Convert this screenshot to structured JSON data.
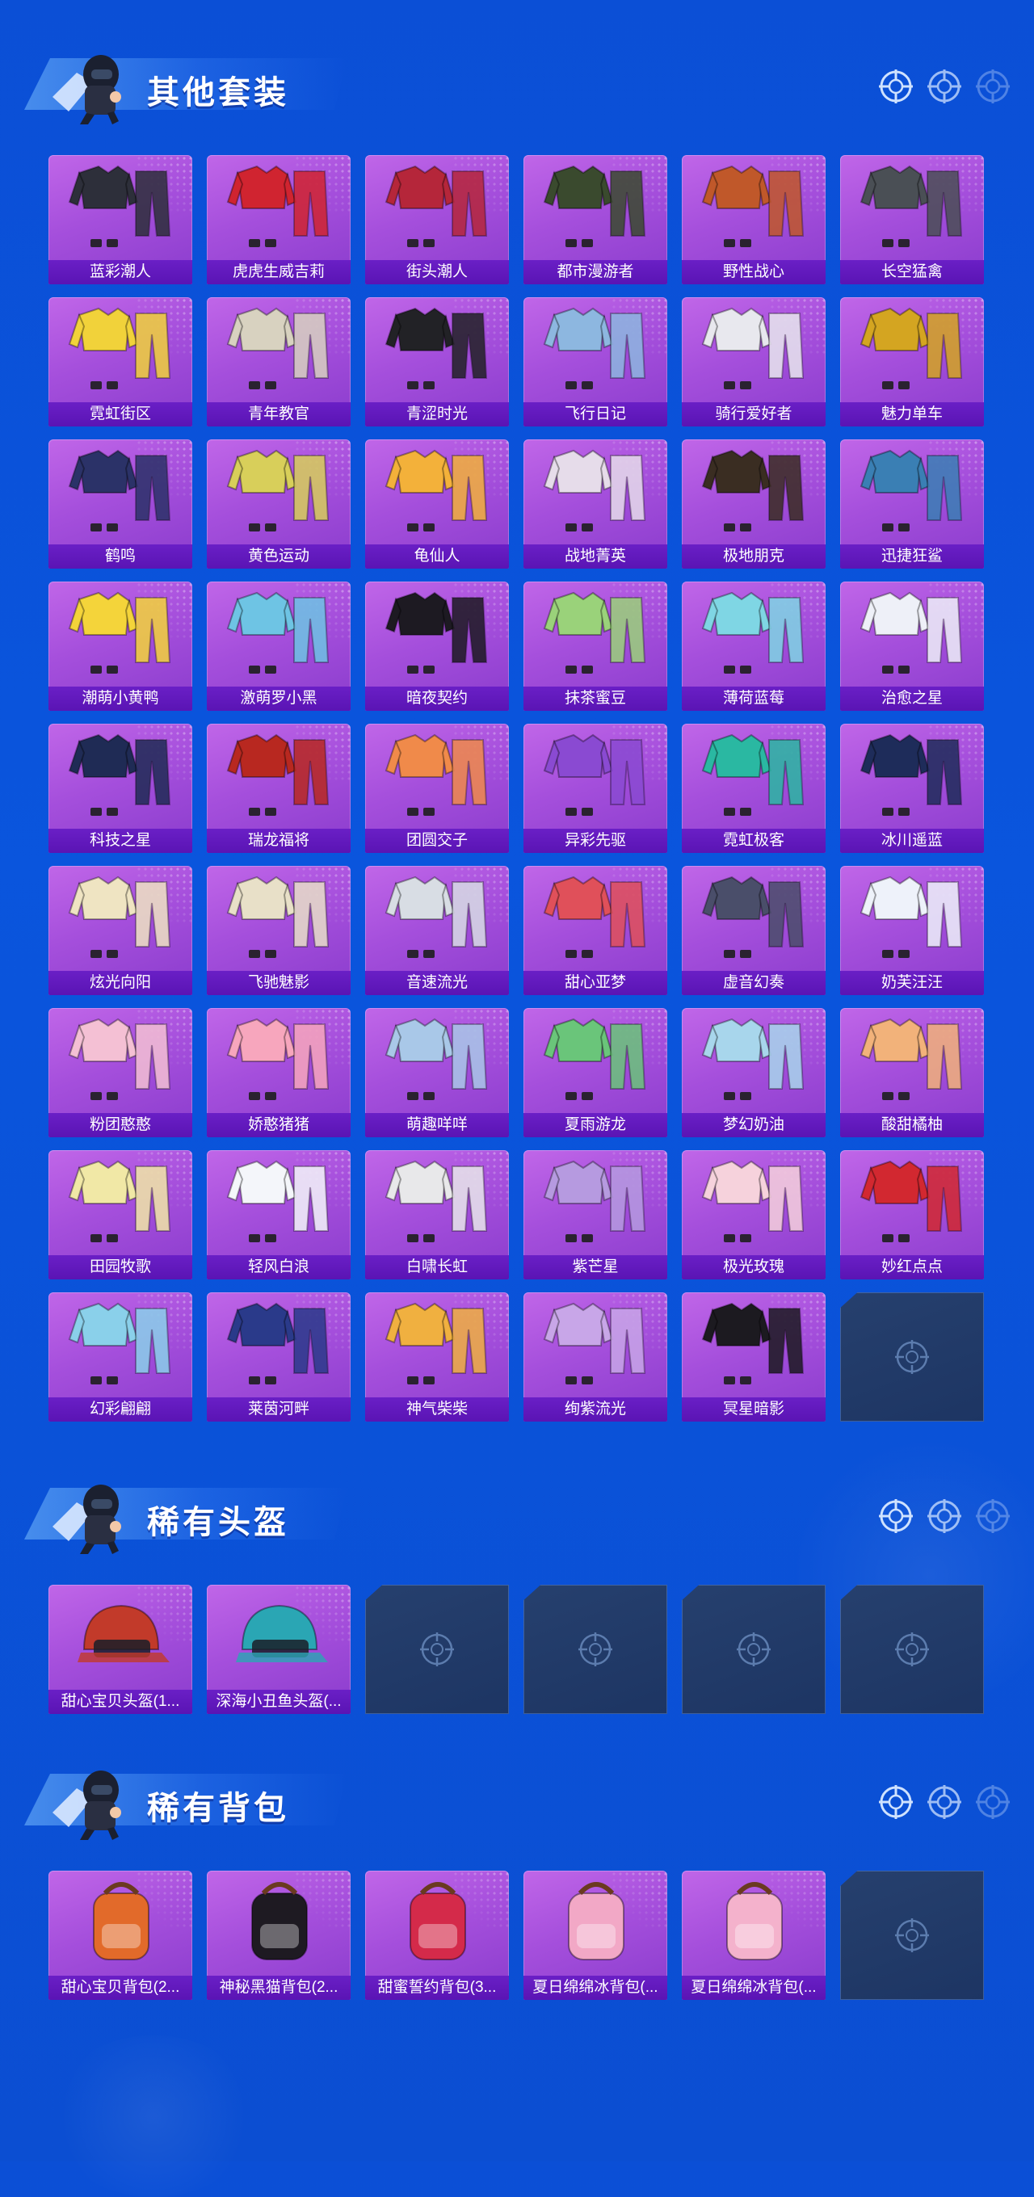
{
  "sections": [
    {
      "title": "其他套装",
      "items": [
        {
          "label": "蓝彩潮人",
          "color": "#2d2f3a"
        },
        {
          "label": "虎虎生威吉莉",
          "color": "#d02430"
        },
        {
          "label": "街头潮人",
          "color": "#b5263a"
        },
        {
          "label": "都市漫游者",
          "color": "#3a4a2e"
        },
        {
          "label": "野性战心",
          "color": "#c0582a"
        },
        {
          "label": "长空猛禽",
          "color": "#4a4f55"
        },
        {
          "label": "霓虹街区",
          "color": "#f1d23a"
        },
        {
          "label": "青年教官",
          "color": "#d8d2c0"
        },
        {
          "label": "青涩时光",
          "color": "#222226"
        },
        {
          "label": "飞行日记",
          "color": "#8db7e0"
        },
        {
          "label": "骑行爱好者",
          "color": "#e8e8ee"
        },
        {
          "label": "魅力单车",
          "color": "#d4a521"
        },
        {
          "label": "鹤鸣",
          "color": "#2b3268"
        },
        {
          "label": "黄色运动",
          "color": "#d8cf5a"
        },
        {
          "label": "龟仙人",
          "color": "#f3b13a"
        },
        {
          "label": "战地菁英",
          "color": "#e6dcea"
        },
        {
          "label": "极地朋克",
          "color": "#3a2d22"
        },
        {
          "label": "迅捷狂鲨",
          "color": "#3a7fb4"
        },
        {
          "label": "潮萌小黄鸭",
          "color": "#f4d43a"
        },
        {
          "label": "激萌罗小黑",
          "color": "#6ec4e4"
        },
        {
          "label": "暗夜契约",
          "color": "#1d1a22"
        },
        {
          "label": "抹茶蜜豆",
          "color": "#9ad27a"
        },
        {
          "label": "薄荷蓝莓",
          "color": "#7fd6e4"
        },
        {
          "label": "治愈之星",
          "color": "#eef0f8"
        },
        {
          "label": "科技之星",
          "color": "#1f2b55"
        },
        {
          "label": "瑞龙福将",
          "color": "#b82820"
        },
        {
          "label": "团圆交子",
          "color": "#f08a4a"
        },
        {
          "label": "异彩先驱",
          "color": "#8a4ad2"
        },
        {
          "label": "霓虹极客",
          "color": "#2ab8a2"
        },
        {
          "label": "冰川遥蓝",
          "color": "#1e2c5a"
        },
        {
          "label": "炫光向阳",
          "color": "#efe4c2"
        },
        {
          "label": "飞驰魅影",
          "color": "#e8e0c8"
        },
        {
          "label": "音速流光",
          "color": "#d8dde4"
        },
        {
          "label": "甜心亚梦",
          "color": "#e0505a"
        },
        {
          "label": "虚音幻奏",
          "color": "#4a4e6a"
        },
        {
          "label": "奶芙汪汪",
          "color": "#eef2fa"
        },
        {
          "label": "粉团憨憨",
          "color": "#f4c0d4"
        },
        {
          "label": "娇憨猪猪",
          "color": "#f7a6bd"
        },
        {
          "label": "萌趣咩咩",
          "color": "#a9c8e8"
        },
        {
          "label": "夏雨游龙",
          "color": "#6ac57a"
        },
        {
          "label": "梦幻奶油",
          "color": "#a8d6ec"
        },
        {
          "label": "酸甜橘柚",
          "color": "#f2b27a"
        },
        {
          "label": "田园牧歌",
          "color": "#f1e8a6"
        },
        {
          "label": "轻风白浪",
          "color": "#f4f6fa"
        },
        {
          "label": "白啸长虹",
          "color": "#e8e8ea"
        },
        {
          "label": "紫芒星",
          "color": "#b69ae0"
        },
        {
          "label": "极光玫瑰",
          "color": "#f6d2dc"
        },
        {
          "label": "妙红点点",
          "color": "#d22830"
        },
        {
          "label": "幻彩翩翩",
          "color": "#8ad0ea"
        },
        {
          "label": "莱茵河畔",
          "color": "#2a3a8a"
        },
        {
          "label": "神气柴柴",
          "color": "#f0b040"
        },
        {
          "label": "绚紫流光",
          "color": "#c8a6e8"
        },
        {
          "label": "冥星暗影",
          "color": "#1c1a20"
        },
        {
          "label": "",
          "empty": true
        }
      ]
    },
    {
      "title": "稀有头盔",
      "items": [
        {
          "label": "甜心宝贝头盔(1...",
          "color": "#c23a2a"
        },
        {
          "label": "深海小丑鱼头盔(...",
          "color": "#2aa6b4"
        },
        {
          "label": "",
          "empty": true
        },
        {
          "label": "",
          "empty": true
        },
        {
          "label": "",
          "empty": true
        },
        {
          "label": "",
          "empty": true
        }
      ]
    },
    {
      "title": "稀有背包",
      "items": [
        {
          "label": "甜心宝贝背包(2...",
          "color": "#e26a2a"
        },
        {
          "label": "神秘黑猫背包(2...",
          "color": "#1e1a22"
        },
        {
          "label": "甜蜜誓约背包(3...",
          "color": "#d42a4a"
        },
        {
          "label": "夏日绵绵冰背包(...",
          "color": "#f2a8c6"
        },
        {
          "label": "夏日绵绵冰背包(...",
          "color": "#f4b2cc"
        },
        {
          "label": "",
          "empty": true
        }
      ]
    }
  ]
}
